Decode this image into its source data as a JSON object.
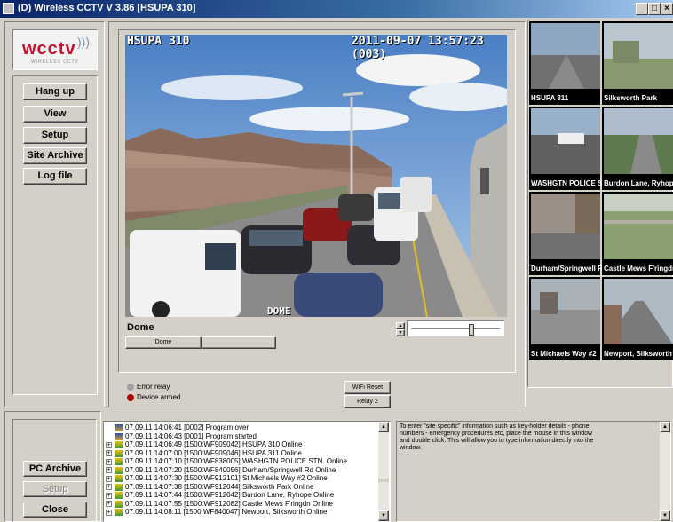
{
  "window": {
    "title": "(D) Wireless CCTV   V 3.86  [HSUPA 310]",
    "min_glyph": "_",
    "max_glyph": "□",
    "close_glyph": "×"
  },
  "logo": {
    "text": "wcctv",
    "subtext": "WIRELESS CCTV"
  },
  "sidebar": {
    "buttons": [
      "Hang up",
      "View",
      "Setup",
      "Site Archive",
      "Log file"
    ]
  },
  "camera": {
    "name_overlay": "HSUPA 310",
    "datetime_overlay": "2011-09-07 13:57:23 (003)",
    "bottom_overlay": "DOME",
    "caption": "Dome",
    "tab_label": "Dome",
    "slider_fraction": 0.68
  },
  "status": {
    "error_relay": "Error relay",
    "device_armed": "Device armed",
    "error_relay_color": "#a0a0a0",
    "device_armed_color": "#b00000"
  },
  "actions": {
    "wifi_reset": "WiFi Reset",
    "relay2": "Relay 2"
  },
  "thumbnails": [
    {
      "label": "HSUPA 311"
    },
    {
      "label": "Silksworth Park"
    },
    {
      "label": "WASHGTN POLICE STN."
    },
    {
      "label": "Burdon Lane, Ryhope"
    },
    {
      "label": "Durham/Springwell Rd"
    },
    {
      "label": "Castle Mews F'ringdn"
    },
    {
      "label": "St Michaels Way #2"
    },
    {
      "label": "Newport, Silksworth"
    }
  ],
  "bottom_buttons": {
    "pc_archive": "PC Archive",
    "setup": "Setup",
    "close": "Close"
  },
  "log": [
    {
      "text": "07.09.11 14:06:41 [0002] Program over",
      "icon": "hourglass"
    },
    {
      "text": "07.09.11 14:06:43 [0001] Program started",
      "icon": "hourglass"
    },
    {
      "text": "07.09.11 14:06:49 [1500:WF909042] HSUPA 310 Online",
      "icon": "camera"
    },
    {
      "text": "07.09.11 14:07:00 [1500:WF909046] HSUPA 311 Online",
      "icon": "camera"
    },
    {
      "text": "07.09.11 14:07:10 [1500:WF838005] WASHGTN POLICE STN. Online",
      "icon": "camera"
    },
    {
      "text": "07.09.11 14:07:20 [1500:WF840056] Durham/Springwell Rd Online",
      "icon": "camera"
    },
    {
      "text": "07.09.11 14:07:30 [1500:WF912101] St Michaels Way #2 Online",
      "icon": "camera"
    },
    {
      "text": "07.09.11 14:07:38 [1500:WF912044] Silksworth Park Online",
      "icon": "camera"
    },
    {
      "text": "07.09.11 14:07:44 [1500:WF912042] Burdon Lane, Ryhope Online",
      "icon": "camera"
    },
    {
      "text": "07.09.11 14:07:55 [1500:WF912082] Castle Mews F'ringdn Online",
      "icon": "camera"
    },
    {
      "text": "07.09.11 14:08:11 [1500:WF840047] Newport, Silksworth Online",
      "icon": "camera"
    }
  ],
  "notes": {
    "text": "To enter \"site specific\" information such as key-holder details - phone numbers - emergency procedures etc, place the mouse in this window and double click. This will allow you to type information directly into the window."
  }
}
